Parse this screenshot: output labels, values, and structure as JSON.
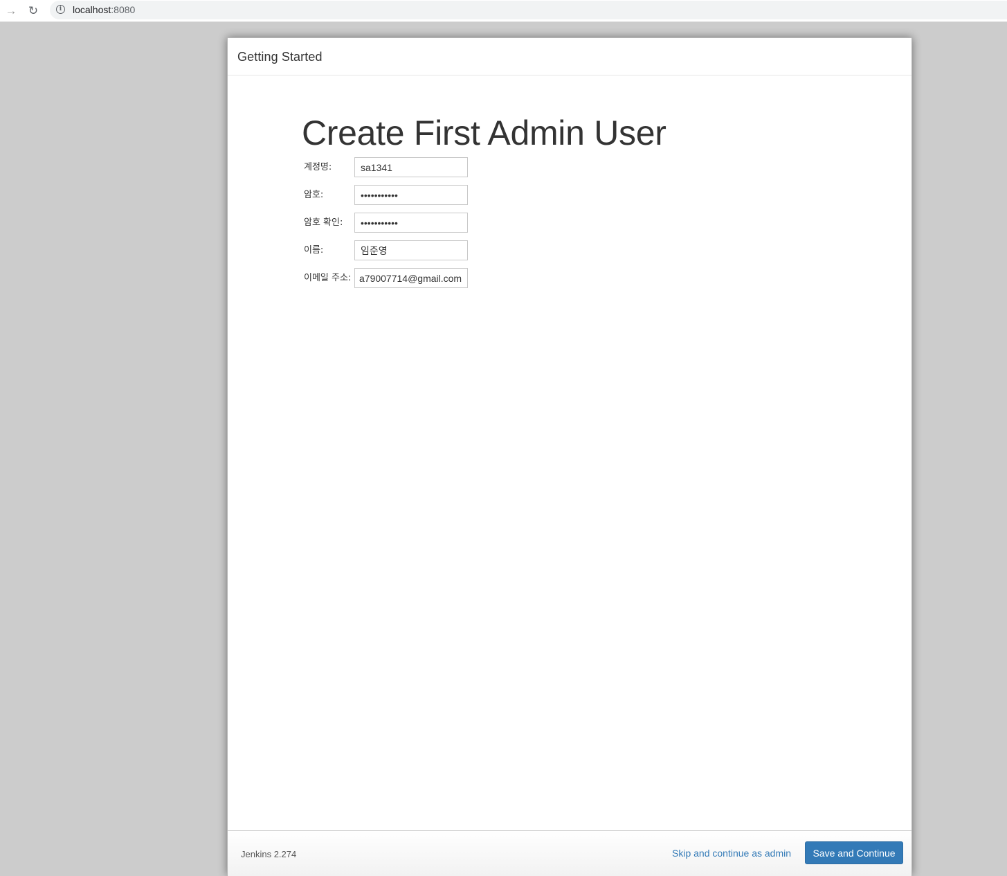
{
  "browser": {
    "url_host": "localhost",
    "url_port": ":8080",
    "forward_icon": "arrow-right-icon",
    "reload_icon": "reload-icon",
    "info_icon": "info-icon"
  },
  "dialog": {
    "title": "Getting Started",
    "heading": "Create First Admin User",
    "form": {
      "username_label": "계정명:",
      "username_value": "sa1341",
      "password_label": "암호:",
      "password_value": "•••••••••••",
      "confirm_label": "암호 확인:",
      "confirm_value": "•••••••••••",
      "fullname_label": "이름:",
      "fullname_value": "임준영",
      "email_label": "이메일 주소:",
      "email_value": "a79007714@gmail.com"
    },
    "footer": {
      "version": "Jenkins 2.274",
      "skip_label": "Skip and continue as admin",
      "save_label": "Save and Continue"
    }
  },
  "colors": {
    "primary": "#337ab7",
    "backdrop": "#cccccc",
    "text": "#333333"
  }
}
